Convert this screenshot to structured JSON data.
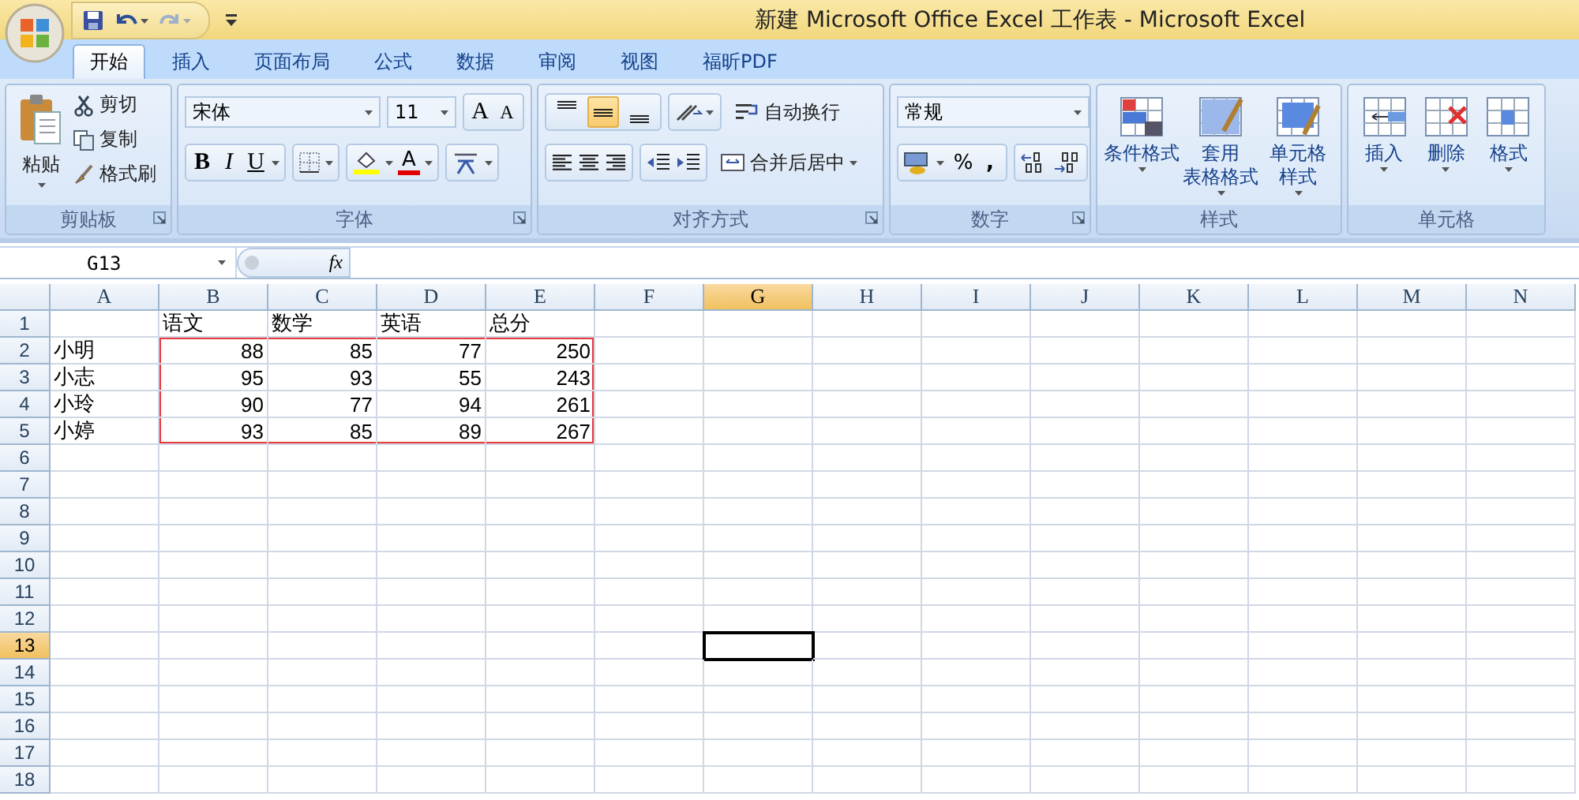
{
  "window": {
    "title": "新建 Microsoft Office Excel 工作表 - Microsoft Excel"
  },
  "tabs": [
    {
      "label": "开始",
      "selected": true
    },
    {
      "label": "插入",
      "selected": false
    },
    {
      "label": "页面布局",
      "selected": false
    },
    {
      "label": "公式",
      "selected": false
    },
    {
      "label": "数据",
      "selected": false
    },
    {
      "label": "审阅",
      "selected": false
    },
    {
      "label": "视图",
      "selected": false
    },
    {
      "label": "福昕PDF",
      "selected": false
    }
  ],
  "ribbon": [
    {
      "kind": "clipboard",
      "label": "剪贴板",
      "large": "粘贴",
      "small": [
        "剪切",
        "复制",
        "格式刷"
      ]
    },
    {
      "kind": "font",
      "label": "字体",
      "font_name": "宋体",
      "font_size": "11",
      "grow": "A",
      "shrink": "A",
      "styles": [
        "B",
        "I",
        "U"
      ],
      "font_color": "A"
    },
    {
      "kind": "alignment",
      "label": "对齐方式",
      "wrap": "自动换行",
      "merge": "合并后居中",
      "vertical": [
        {
          "selected": false
        },
        {
          "selected": true
        },
        {
          "selected": false
        }
      ]
    },
    {
      "kind": "number",
      "label": "数字",
      "format": "常规",
      "symbols": [
        "%",
        ","
      ]
    },
    {
      "kind": "large",
      "label": "样式",
      "buttons": [
        {
          "lines": [
            "条件格式"
          ]
        },
        {
          "lines": [
            "套用",
            "表格格式"
          ]
        },
        {
          "lines": [
            "单元格",
            "样式"
          ]
        }
      ]
    },
    {
      "kind": "large",
      "label": "单元格",
      "buttons": [
        {
          "lines": [
            "插入"
          ]
        },
        {
          "lines": [
            "删除"
          ]
        },
        {
          "lines": [
            "格式"
          ]
        }
      ]
    }
  ],
  "name_box": "G13",
  "fx": "fx",
  "columns": [
    {
      "label": "A",
      "selected": false
    },
    {
      "label": "B",
      "selected": false
    },
    {
      "label": "C",
      "selected": false
    },
    {
      "label": "D",
      "selected": false
    },
    {
      "label": "E",
      "selected": false
    },
    {
      "label": "F",
      "selected": false
    },
    {
      "label": "G",
      "selected": true
    },
    {
      "label": "H",
      "selected": false
    },
    {
      "label": "I",
      "selected": false
    },
    {
      "label": "J",
      "selected": false
    },
    {
      "label": "K",
      "selected": false
    },
    {
      "label": "L",
      "selected": false
    },
    {
      "label": "M",
      "selected": false
    },
    {
      "label": "N",
      "selected": false
    }
  ],
  "rows": [
    {
      "label": "1",
      "selected": false,
      "cells": {
        "B": {
          "text": "语文",
          "kind": "text",
          "framed": false
        },
        "C": {
          "text": "数学",
          "kind": "text",
          "framed": false
        },
        "D": {
          "text": "英语",
          "kind": "text",
          "framed": false
        },
        "E": {
          "text": "总分",
          "kind": "text",
          "framed": false
        }
      }
    },
    {
      "label": "2",
      "selected": false,
      "cells": {
        "A": {
          "text": "小明",
          "kind": "text",
          "framed": false
        },
        "B": {
          "text": "88",
          "kind": "number",
          "framed": true
        },
        "C": {
          "text": "85",
          "kind": "number",
          "framed": true
        },
        "D": {
          "text": "77",
          "kind": "number",
          "framed": true
        },
        "E": {
          "text": "250",
          "kind": "number",
          "framed": true
        }
      }
    },
    {
      "label": "3",
      "selected": false,
      "cells": {
        "A": {
          "text": "小志",
          "kind": "text",
          "framed": false
        },
        "B": {
          "text": "95",
          "kind": "number",
          "framed": true
        },
        "C": {
          "text": "93",
          "kind": "number",
          "framed": true
        },
        "D": {
          "text": "55",
          "kind": "number",
          "framed": true
        },
        "E": {
          "text": "243",
          "kind": "number",
          "framed": true
        }
      }
    },
    {
      "label": "4",
      "selected": false,
      "cells": {
        "A": {
          "text": "小玲",
          "kind": "text",
          "framed": false
        },
        "B": {
          "text": "90",
          "kind": "number",
          "framed": true
        },
        "C": {
          "text": "77",
          "kind": "number",
          "framed": true
        },
        "D": {
          "text": "94",
          "kind": "number",
          "framed": true
        },
        "E": {
          "text": "261",
          "kind": "number",
          "framed": true
        }
      }
    },
    {
      "label": "5",
      "selected": false,
      "cells": {
        "A": {
          "text": "小婷",
          "kind": "text",
          "framed": false
        },
        "B": {
          "text": "93",
          "kind": "number",
          "framed": true
        },
        "C": {
          "text": "85",
          "kind": "number",
          "framed": true
        },
        "D": {
          "text": "89",
          "kind": "number",
          "framed": true
        },
        "E": {
          "text": "267",
          "kind": "number",
          "framed": true
        }
      }
    },
    {
      "label": "6",
      "selected": false
    },
    {
      "label": "7",
      "selected": false
    },
    {
      "label": "8",
      "selected": false
    },
    {
      "label": "9",
      "selected": false
    },
    {
      "label": "10",
      "selected": false
    },
    {
      "label": "11",
      "selected": false
    },
    {
      "label": "12",
      "selected": false
    },
    {
      "label": "13",
      "selected": true
    },
    {
      "label": "14",
      "selected": false
    },
    {
      "label": "15",
      "selected": false
    },
    {
      "label": "16",
      "selected": false
    },
    {
      "label": "17",
      "selected": false
    },
    {
      "label": "18",
      "selected": false
    }
  ]
}
